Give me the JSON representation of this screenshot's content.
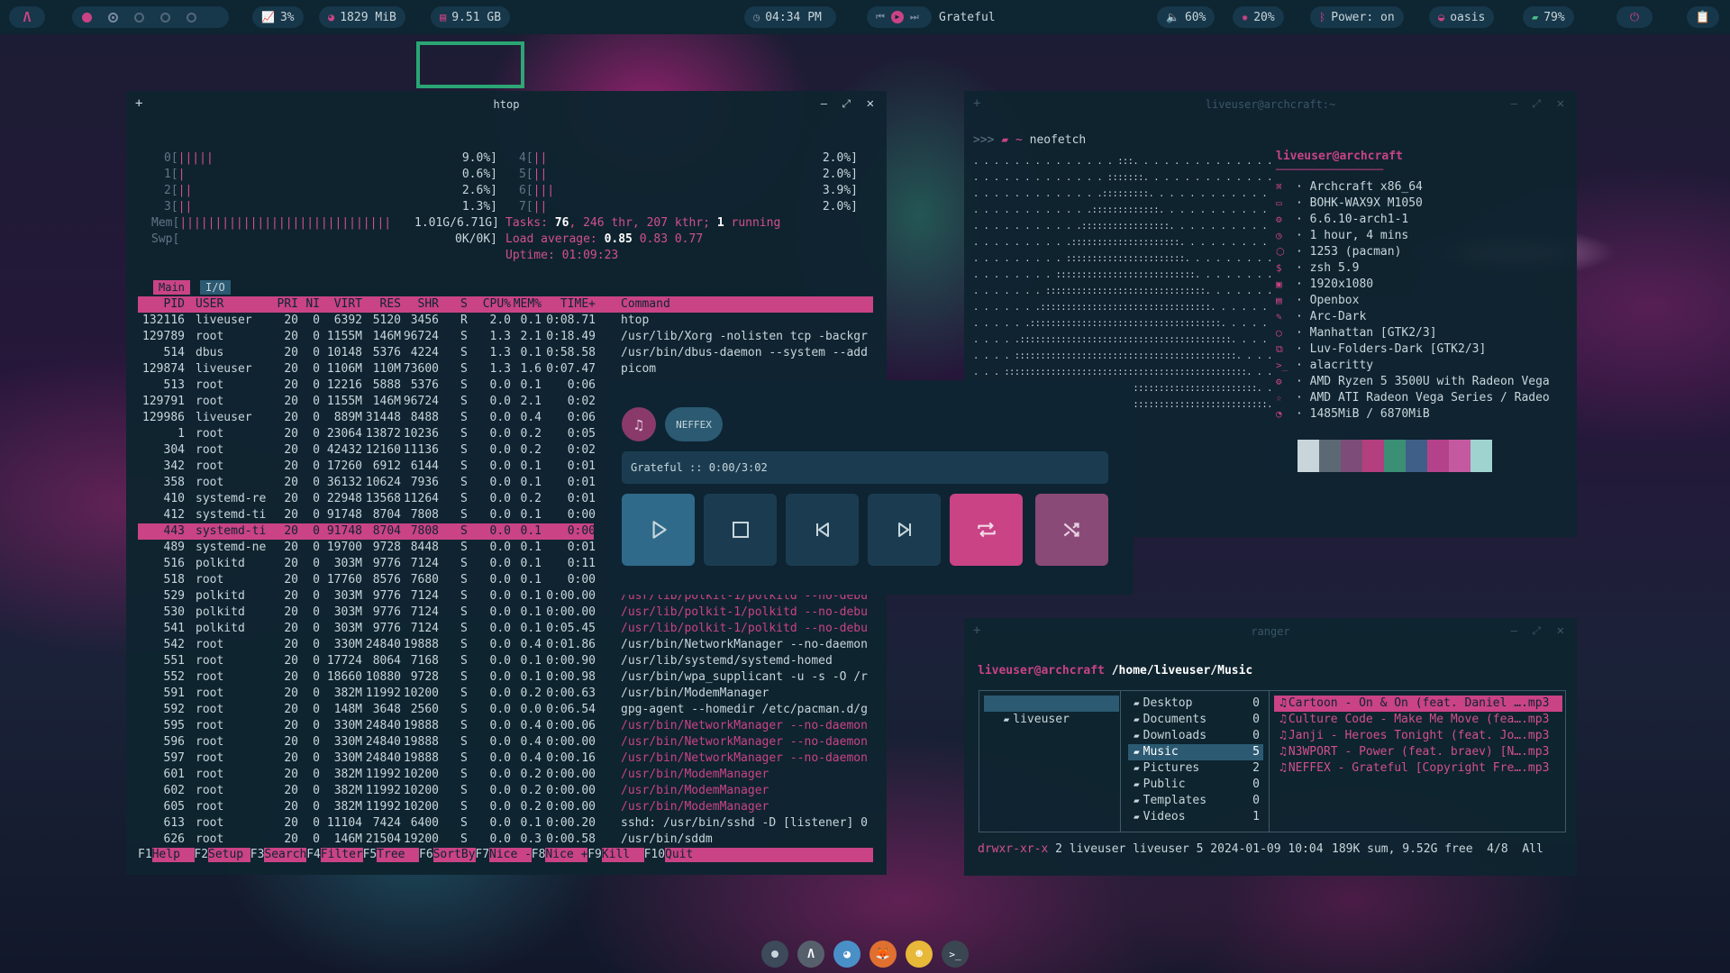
{
  "topbar": {
    "launcher_icon": "archcraft-logo-icon",
    "cpu": "3%",
    "memory": "1829 MiB",
    "disk": "9.51 GB",
    "clock": "04:34 PM",
    "track": "Grateful",
    "volume": "60%",
    "brightness": "20%",
    "bluetooth": "Power: on",
    "wifi": "oasis",
    "battery": "79%"
  },
  "htop": {
    "title": "htop",
    "cpus": [
      {
        "label": "0[",
        "bar": "|||||",
        "pct": "9.0%]"
      },
      {
        "label": "1[",
        "bar": "|",
        "pct": "0.6%]"
      },
      {
        "label": "2[",
        "bar": "||",
        "pct": "2.6%]"
      },
      {
        "label": "3[",
        "bar": "||",
        "pct": "1.3%]"
      },
      {
        "label": "4[",
        "bar": "||",
        "pct": "2.0%]"
      },
      {
        "label": "5[",
        "bar": "||",
        "pct": "2.0%]"
      },
      {
        "label": "6[",
        "bar": "|||",
        "pct": "3.9%]"
      },
      {
        "label": "7[",
        "bar": "||",
        "pct": "2.0%]"
      }
    ],
    "mem_label": "Mem[",
    "mem_bar": "||||||||||||||||||||||||||||||",
    "mem_value": "1.01G/6.71G]",
    "swp_label": "Swp[",
    "swp_value": "0K/0K]",
    "tasks_label": "Tasks:",
    "tasks": "76",
    "thr": "246",
    "thr_label": "thr,",
    "kthr": "207 kthr;",
    "running": "1",
    "running_label": "running",
    "load_label": "Load average:",
    "load1": "0.85",
    "load5": "0.83",
    "load15": "0.77",
    "uptime_label": "Uptime:",
    "uptime": "01:09:23",
    "tab_main": "Main",
    "tab_io": "I/O",
    "headers": [
      "PID",
      "USER",
      "PRI",
      "NI",
      "VIRT",
      "RES",
      "SHR",
      "S",
      "CPU%",
      "MEM%",
      "TIME+",
      "Command"
    ],
    "rows": [
      [
        "132116",
        "liveuser",
        "20",
        "0",
        "6392",
        "5120",
        "3456",
        "R",
        "2.0",
        "0.1",
        "0:08.71",
        "htop"
      ],
      [
        "129789",
        "root",
        "20",
        "0",
        "1155M",
        "146M",
        "96724",
        "S",
        "1.3",
        "2.1",
        "0:18.49",
        "/usr/lib/Xorg -nolisten tcp -backgr"
      ],
      [
        "514",
        "dbus",
        "20",
        "0",
        "10148",
        "5376",
        "4224",
        "S",
        "1.3",
        "0.1",
        "0:58.58",
        "/usr/bin/dbus-daemon --system --add"
      ],
      [
        "129874",
        "liveuser",
        "20",
        "0",
        "1106M",
        "110M",
        "73600",
        "S",
        "1.3",
        "1.6",
        "0:07.47",
        "picom"
      ],
      [
        "513",
        "root",
        "20",
        "0",
        "12216",
        "5888",
        "5376",
        "S",
        "0.0",
        "0.1",
        "0:06",
        ""
      ],
      [
        "129791",
        "root",
        "20",
        "0",
        "1155M",
        "146M",
        "96724",
        "S",
        "0.0",
        "2.1",
        "0:02",
        ""
      ],
      [
        "129986",
        "liveuser",
        "20",
        "0",
        "889M",
        "31448",
        "8488",
        "S",
        "0.0",
        "0.4",
        "0:06",
        ""
      ],
      [
        "1",
        "root",
        "20",
        "0",
        "23064",
        "13872",
        "10236",
        "S",
        "0.0",
        "0.2",
        "0:05",
        ""
      ],
      [
        "304",
        "root",
        "20",
        "0",
        "42432",
        "12160",
        "11136",
        "S",
        "0.0",
        "0.2",
        "0:02",
        ""
      ],
      [
        "342",
        "root",
        "20",
        "0",
        "17260",
        "6912",
        "6144",
        "S",
        "0.0",
        "0.1",
        "0:01",
        ""
      ],
      [
        "358",
        "root",
        "20",
        "0",
        "36132",
        "10624",
        "7936",
        "S",
        "0.0",
        "0.1",
        "0:01",
        ""
      ],
      [
        "410",
        "systemd-re",
        "20",
        "0",
        "22948",
        "13568",
        "11264",
        "S",
        "0.0",
        "0.2",
        "0:01",
        ""
      ],
      [
        "412",
        "systemd-ti",
        "20",
        "0",
        "91748",
        "8704",
        "7808",
        "S",
        "0.0",
        "0.1",
        "0:00",
        ""
      ],
      [
        "443",
        "systemd-ti",
        "20",
        "0",
        "91748",
        "8704",
        "7808",
        "S",
        "0.0",
        "0.1",
        "0:00",
        ""
      ],
      [
        "489",
        "systemd-ne",
        "20",
        "0",
        "19700",
        "9728",
        "8448",
        "S",
        "0.0",
        "0.1",
        "0:01",
        ""
      ],
      [
        "516",
        "polkitd",
        "20",
        "0",
        "303M",
        "9776",
        "7124",
        "S",
        "0.0",
        "0.1",
        "0:11",
        ""
      ],
      [
        "518",
        "root",
        "20",
        "0",
        "17760",
        "8576",
        "7680",
        "S",
        "0.0",
        "0.1",
        "0:00",
        ""
      ],
      [
        "529",
        "polkitd",
        "20",
        "0",
        "303M",
        "9776",
        "7124",
        "S",
        "0.0",
        "0.1",
        "0:00.00",
        "/usr/lib/polkit-1/polkitd --no-debu"
      ],
      [
        "530",
        "polkitd",
        "20",
        "0",
        "303M",
        "9776",
        "7124",
        "S",
        "0.0",
        "0.1",
        "0:00.00",
        "/usr/lib/polkit-1/polkitd --no-debu"
      ],
      [
        "541",
        "polkitd",
        "20",
        "0",
        "303M",
        "9776",
        "7124",
        "S",
        "0.0",
        "0.1",
        "0:05.45",
        "/usr/lib/polkit-1/polkitd --no-debu"
      ],
      [
        "542",
        "root",
        "20",
        "0",
        "330M",
        "24840",
        "19888",
        "S",
        "0.0",
        "0.4",
        "0:01.86",
        "/usr/bin/NetworkManager --no-daemon"
      ],
      [
        "551",
        "root",
        "20",
        "0",
        "17724",
        "8064",
        "7168",
        "S",
        "0.0",
        "0.1",
        "0:00.90",
        "/usr/lib/systemd/systemd-homed"
      ],
      [
        "552",
        "root",
        "20",
        "0",
        "18660",
        "10880",
        "9728",
        "S",
        "0.0",
        "0.1",
        "0:00.98",
        "/usr/bin/wpa_supplicant -u -s -O /r"
      ],
      [
        "591",
        "root",
        "20",
        "0",
        "382M",
        "11992",
        "10200",
        "S",
        "0.0",
        "0.2",
        "0:00.63",
        "/usr/bin/ModemManager"
      ],
      [
        "592",
        "root",
        "20",
        "0",
        "148M",
        "3648",
        "2560",
        "S",
        "0.0",
        "0.0",
        "0:06.54",
        "gpg-agent --homedir /etc/pacman.d/g"
      ],
      [
        "595",
        "root",
        "20",
        "0",
        "330M",
        "24840",
        "19888",
        "S",
        "0.0",
        "0.4",
        "0:00.06",
        "/usr/bin/NetworkManager --no-daemon"
      ],
      [
        "596",
        "root",
        "20",
        "0",
        "330M",
        "24840",
        "19888",
        "S",
        "0.0",
        "0.4",
        "0:00.00",
        "/usr/bin/NetworkManager --no-daemon"
      ],
      [
        "597",
        "root",
        "20",
        "0",
        "330M",
        "24840",
        "19888",
        "S",
        "0.0",
        "0.4",
        "0:00.16",
        "/usr/bin/NetworkManager --no-daemon"
      ],
      [
        "601",
        "root",
        "20",
        "0",
        "382M",
        "11992",
        "10200",
        "S",
        "0.0",
        "0.2",
        "0:00.00",
        "/usr/bin/ModemManager"
      ],
      [
        "602",
        "root",
        "20",
        "0",
        "382M",
        "11992",
        "10200",
        "S",
        "0.0",
        "0.2",
        "0:00.00",
        "/usr/bin/ModemManager"
      ],
      [
        "605",
        "root",
        "20",
        "0",
        "382M",
        "11992",
        "10200",
        "S",
        "0.0",
        "0.2",
        "0:00.00",
        "/usr/bin/ModemManager"
      ],
      [
        "613",
        "root",
        "20",
        "0",
        "11104",
        "7424",
        "6400",
        "S",
        "0.0",
        "0.1",
        "0:00.20",
        "sshd: /usr/bin/sshd -D [listener] 0"
      ],
      [
        "626",
        "root",
        "20",
        "0",
        "146M",
        "21504",
        "19200",
        "S",
        "0.0",
        "0.3",
        "0:00.58",
        "/usr/bin/sddm"
      ]
    ],
    "fkeys": [
      {
        "k": "F1",
        "l": "Help  "
      },
      {
        "k": "F2",
        "l": "Setup "
      },
      {
        "k": "F3",
        "l": "Search"
      },
      {
        "k": "F4",
        "l": "Filter"
      },
      {
        "k": "F5",
        "l": "Tree  "
      },
      {
        "k": "F6",
        "l": "SortBy"
      },
      {
        "k": "F7",
        "l": "Nice -"
      },
      {
        "k": "F8",
        "l": "Nice +"
      },
      {
        "k": "F9",
        "l": "Kill  "
      },
      {
        "k": "F10",
        "l": "Quit"
      }
    ]
  },
  "neofetch": {
    "title": "liveuser@archcraft:~",
    "prompt": ">>> ",
    "path": "~",
    "command": "neofetch",
    "user_host": "liveuser@archcraft",
    "separator": "──────────────────",
    "info": [
      {
        "icon": "arch-icon",
        "glyph": "⌘",
        "text": "· Archcraft x86_64"
      },
      {
        "icon": "monitor-icon",
        "glyph": "▭",
        "text": "· BOHK-WAX9X M1050"
      },
      {
        "icon": "kernel-icon",
        "glyph": "⚙",
        "text": "· 6.6.10-arch1-1"
      },
      {
        "icon": "clock-icon",
        "glyph": "◷",
        "text": "· 1 hour, 4 mins"
      },
      {
        "icon": "package-icon",
        "glyph": "⬡",
        "text": "· 1253 (pacman)"
      },
      {
        "icon": "shell-icon",
        "glyph": "$",
        "text": "· zsh 5.9"
      },
      {
        "icon": "resolution-icon",
        "glyph": "▣",
        "text": "· 1920x1080"
      },
      {
        "icon": "wm-icon",
        "glyph": "▤",
        "text": "· Openbox"
      },
      {
        "icon": "theme-icon",
        "glyph": "✎",
        "text": "· Arc-Dark"
      },
      {
        "icon": "gtk-icon",
        "glyph": "◯",
        "text": "· Manhattan [GTK2/3]"
      },
      {
        "icon": "icons-icon",
        "glyph": "⧉",
        "text": "· Luv-Folders-Dark [GTK2/3]"
      },
      {
        "icon": "terminal-icon",
        "glyph": ">_",
        "text": "· alacritty"
      },
      {
        "icon": "cpu-icon",
        "glyph": "⚙",
        "text": "· AMD Ryzen 5 3500U with Radeon Vega"
      },
      {
        "icon": "gpu-icon",
        "glyph": "☆",
        "text": "· AMD ATI Radeon Vega Series / Radeo"
      },
      {
        "icon": "memory-icon",
        "glyph": "◔",
        "text": "· 1485MiB / 6870MiB"
      }
    ],
    "swatches": [
      "#0e2432",
      "#c8d6dc",
      "#5d6875",
      "#7d4c78",
      "#b33f7e",
      "#3a8f74",
      "#3f5f88",
      "#b4428a",
      "#c459a0",
      "#9fd3d0"
    ]
  },
  "player": {
    "artist": "NEFFEX",
    "status": "Grateful :: 0:00/3:02",
    "buttons": [
      "play",
      "stop",
      "previous",
      "next",
      "repeat",
      "shuffle"
    ]
  },
  "ranger": {
    "title": "ranger",
    "user_host": "liveuser@archcraft",
    "path": "/home/liveuser/Music",
    "parent": "liveuser",
    "dirs": [
      {
        "name": "Desktop",
        "count": "0"
      },
      {
        "name": "Documents",
        "count": "0"
      },
      {
        "name": "Downloads",
        "count": "0"
      },
      {
        "name": "Music",
        "count": "5"
      },
      {
        "name": "Pictures",
        "count": "2"
      },
      {
        "name": "Public",
        "count": "0"
      },
      {
        "name": "Templates",
        "count": "0"
      },
      {
        "name": "Videos",
        "count": "1"
      }
    ],
    "files": [
      "Cartoon - On & On (feat. Daniel ….mp3",
      "Culture Code - Make Me Move (fea….mp3",
      "Janji - Heroes Tonight (feat. Jo….mp3",
      "N3WPORT - Power (feat. braev) [N….mp3",
      "NEFFEX - Grateful [Copyright Fre….mp3"
    ],
    "status_perm": "drwxr-xr-x",
    "status_info": "2 liveuser liveuser 5 2024-01-09 10:04",
    "status_free": "189K sum, 9.52G free  4/8  All"
  },
  "colors": {
    "accent": "#c94385",
    "panel": "#0e2432",
    "button": "#1b3c50",
    "muted": "#607584"
  }
}
